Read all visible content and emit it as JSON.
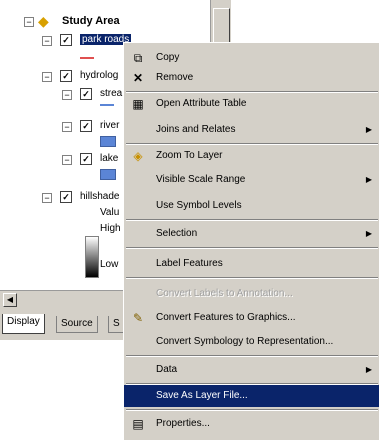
{
  "toc": {
    "root_label": "Study Area",
    "layers": [
      {
        "label": "park roads",
        "checked": true,
        "selected": true
      },
      {
        "label": "hydrolog",
        "checked": true
      },
      {
        "label": "strea",
        "checked": true
      },
      {
        "label": "river",
        "checked": true
      },
      {
        "label": "lake",
        "checked": true
      },
      {
        "label": "hillshade",
        "checked": true
      }
    ],
    "hillshade_value_label": "Valu",
    "hillshade_high": "High",
    "hillshade_low": "Low",
    "tabs": [
      "Display",
      "Source",
      "S"
    ]
  },
  "menu": {
    "items": [
      {
        "label": "Copy",
        "icon": "copy-icon"
      },
      {
        "label": "Remove",
        "icon": "remove-icon"
      },
      {
        "label": "Open Attribute Table",
        "icon": "table-icon"
      },
      {
        "label": "Joins and Relates",
        "submenu": true
      },
      {
        "label": "Zoom To Layer",
        "icon": "zoom-to-layer-icon"
      },
      {
        "label": "Visible Scale Range",
        "submenu": true
      },
      {
        "label": "Use Symbol Levels"
      },
      {
        "label": "Selection",
        "submenu": true
      },
      {
        "label": "Label Features"
      },
      {
        "label": "Convert Labels to Annotation...",
        "disabled": true
      },
      {
        "label": "Convert Features to Graphics...",
        "icon": "convert-graphics-icon"
      },
      {
        "label": "Convert Symbology to Representation..."
      },
      {
        "label": "Data",
        "submenu": true
      },
      {
        "label": "Save As Layer File...",
        "highlighted": true
      },
      {
        "label": "Properties...",
        "icon": "properties-icon"
      }
    ]
  },
  "colors": {
    "highlight": "#0a246a",
    "menu_bg": "#d4d0c8",
    "road_symbol": "#e05050",
    "water_symbol": "#5b85d6"
  }
}
